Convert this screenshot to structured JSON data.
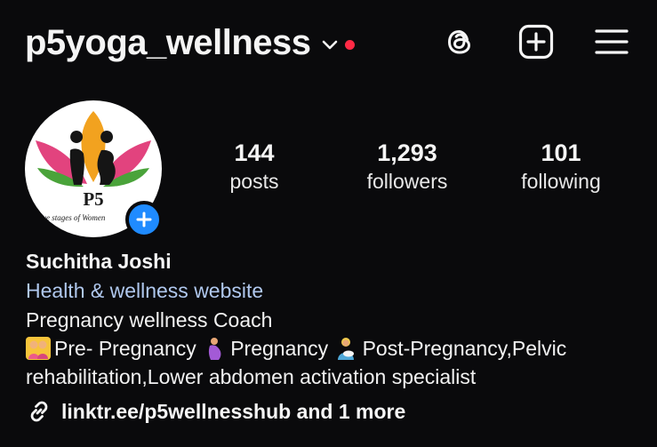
{
  "header": {
    "username": "p5yoga_wellness",
    "icons": [
      "chevron-down-icon",
      "notification-dot",
      "threads-icon",
      "create-icon",
      "menu-icon"
    ],
    "notification_dot_color": "#ff2a45"
  },
  "avatar": {
    "logo_text": "P5",
    "logo_subtext": "Five stages of Women"
  },
  "stats": {
    "posts": {
      "count": "144",
      "label": "posts"
    },
    "followers": {
      "count": "1,293",
      "label": "followers"
    },
    "following": {
      "count": "101",
      "label": "following"
    }
  },
  "bio": {
    "name": "Suchitha Joshi",
    "category": "Health & wellness website",
    "line1": "Pregnancy wellness Coach",
    "line2_a": "Pre- Pregnancy",
    "line2_b": "Pregnancy",
    "line2_c": "Post-Pregnancy,Pelvic",
    "line3": "rehabilitation,Lower abdomen activation specialist",
    "link": "linktr.ee/p5wellnesshub and 1 more"
  },
  "colors": {
    "background": "#0a0a0c",
    "text": "#f5f5f5",
    "category_text": "#b0c8ee",
    "add_button": "#1f8bff"
  }
}
